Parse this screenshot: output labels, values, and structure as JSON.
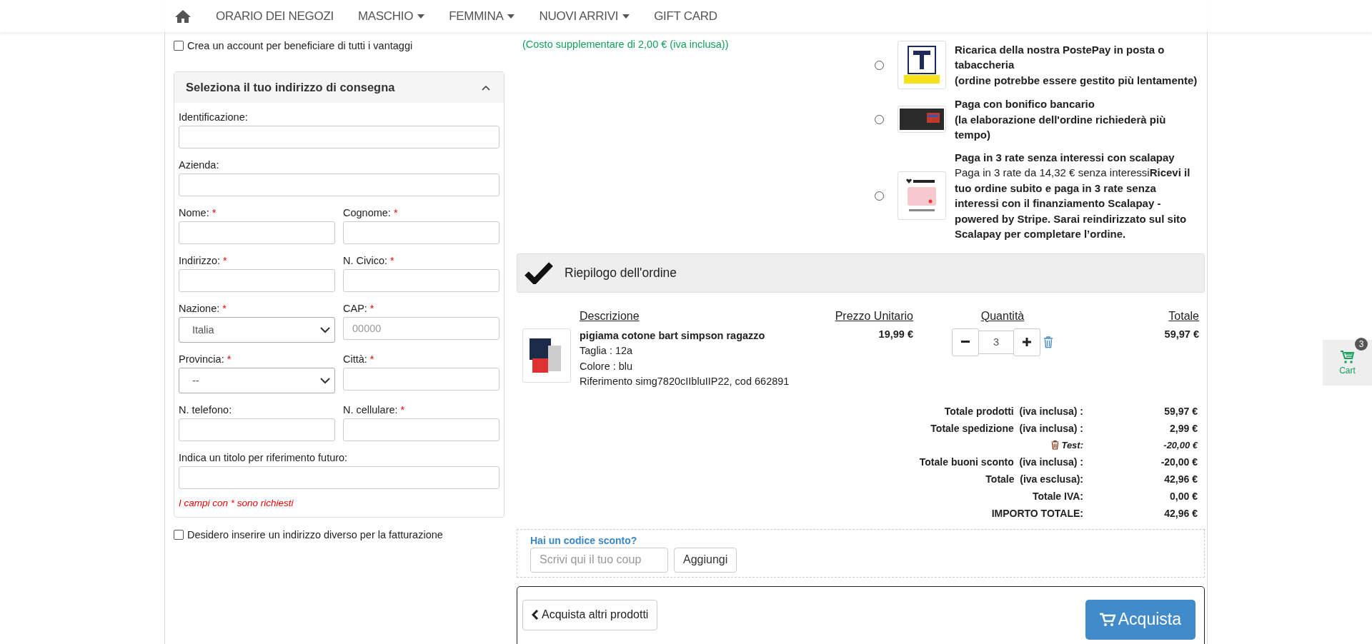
{
  "nav": {
    "items": [
      {
        "label": "ORARIO DEI NEGOZI",
        "has_menu": false
      },
      {
        "label": "MASCHIO",
        "has_menu": true
      },
      {
        "label": "FEMMINA",
        "has_menu": true
      },
      {
        "label": "NUOVI ARRIVI",
        "has_menu": true
      },
      {
        "label": "GIFT CARD",
        "has_menu": false
      }
    ]
  },
  "create_account": {
    "label": "Crea un account per beneficiare di tutti i vantaggi",
    "checked": false
  },
  "address": {
    "title": "Seleziona il tuo indirizzo di consegna",
    "expanded": true,
    "required_mark": "*",
    "rows": [
      [
        {
          "label": "Identificazione:",
          "required": false,
          "kind": "text"
        }
      ],
      [
        {
          "label": "Azienda:",
          "required": false,
          "kind": "text"
        }
      ],
      [
        {
          "label": "Nome:",
          "required": true,
          "kind": "text"
        },
        {
          "label": "Cognome:",
          "required": true,
          "kind": "text"
        }
      ],
      [
        {
          "label": "Indirizzo:",
          "required": true,
          "kind": "text"
        },
        {
          "label": "N. Civico:",
          "required": true,
          "kind": "text"
        }
      ],
      [
        {
          "label": "Nazione:",
          "required": true,
          "kind": "select",
          "value": "Italia"
        },
        {
          "label": "CAP:",
          "required": true,
          "kind": "text",
          "placeholder": "00000"
        }
      ],
      [
        {
          "label": "Provincia:",
          "required": true,
          "kind": "select",
          "value": "--"
        },
        {
          "label": "Città:",
          "required": true,
          "kind": "text"
        }
      ],
      [
        {
          "label": "N. telefono:",
          "required": false,
          "kind": "text"
        },
        {
          "label": "N. cellulare:",
          "required": true,
          "kind": "text"
        }
      ],
      [
        {
          "label": "Indica un titolo per riferimento futuro:",
          "required": false,
          "kind": "text"
        }
      ]
    ],
    "required_note": "I campi con * sono richiesti"
  },
  "billing_checkbox": {
    "label": "Desidero inserire un indirizzo diverso per la fatturazione",
    "checked": false
  },
  "gift": {
    "note": "(Costo supplementare di 2,00 € (iva inclusa))"
  },
  "payments": [
    {
      "kind": "postepay",
      "title": "Ricarica della nostra PostePay in posta o tabaccheria",
      "subtitle": "(ordine potrebbe essere gestito più lentamente)",
      "selected": false
    },
    {
      "kind": "bank",
      "title": "Paga con bonifico bancario",
      "subtitle": "(la elaborazione dell'ordine richiederà più tempo)",
      "selected": false
    },
    {
      "kind": "scalapay",
      "title": "Paga in 3 rate senza interessi con scalapay",
      "description": "Paga in 3 rate da 14,32 € senza interessi**Ricevi il tuo ordine subito e paga in 3 rate senza interessi con il finanziamento Scalapay - powered by Stripe. Sarai reindirizzato sul sito Scalapay per completare l’ordine.**",
      "selected": false
    }
  ],
  "summary": {
    "title": "Riepilogo dell'ordine",
    "columns": [
      "Descrizione",
      "Prezzo Unitario",
      "Quantità",
      "Totale"
    ],
    "items": [
      {
        "name": "pigiama cotone bart simpson ragazzo",
        "details": [
          "Taglia : 12a",
          "Colore : blu",
          "Riferimento simg7820cIIbluIIP22, cod 662891"
        ],
        "price": "19,99 €",
        "quantity": "3",
        "total": "59,97 €"
      }
    ],
    "totals": [
      {
        "kind": "total",
        "label": "Totale prodotti  (iva inclusa) :",
        "value": "59,97 €"
      },
      {
        "kind": "total",
        "label": "Totale spedizione  (iva inclusa) :",
        "value": "2,99 €"
      },
      {
        "kind": "voucher",
        "label": "Test:",
        "value": "-20,00 €"
      },
      {
        "kind": "total",
        "label": "Totale buoni sconto  (iva inclusa) :",
        "value": "-20,00 €"
      },
      {
        "kind": "total",
        "label": "Totale  (iva esclusa):",
        "value": "42,96 €"
      },
      {
        "kind": "total",
        "label": "Totale IVA:",
        "value": "0,00 €"
      },
      {
        "kind": "total",
        "label": "IMPORTO TOTALE:",
        "value": "42,96 €"
      }
    ]
  },
  "coupon": {
    "title": "Hai un codice sconto?",
    "placeholder": "Scrivi qui il tuo coup",
    "button": "Aggiungi"
  },
  "actions": {
    "back": "Acquista altri prodotti",
    "buy": "Acquista"
  },
  "cart": {
    "label": "Cart",
    "count": "3"
  }
}
